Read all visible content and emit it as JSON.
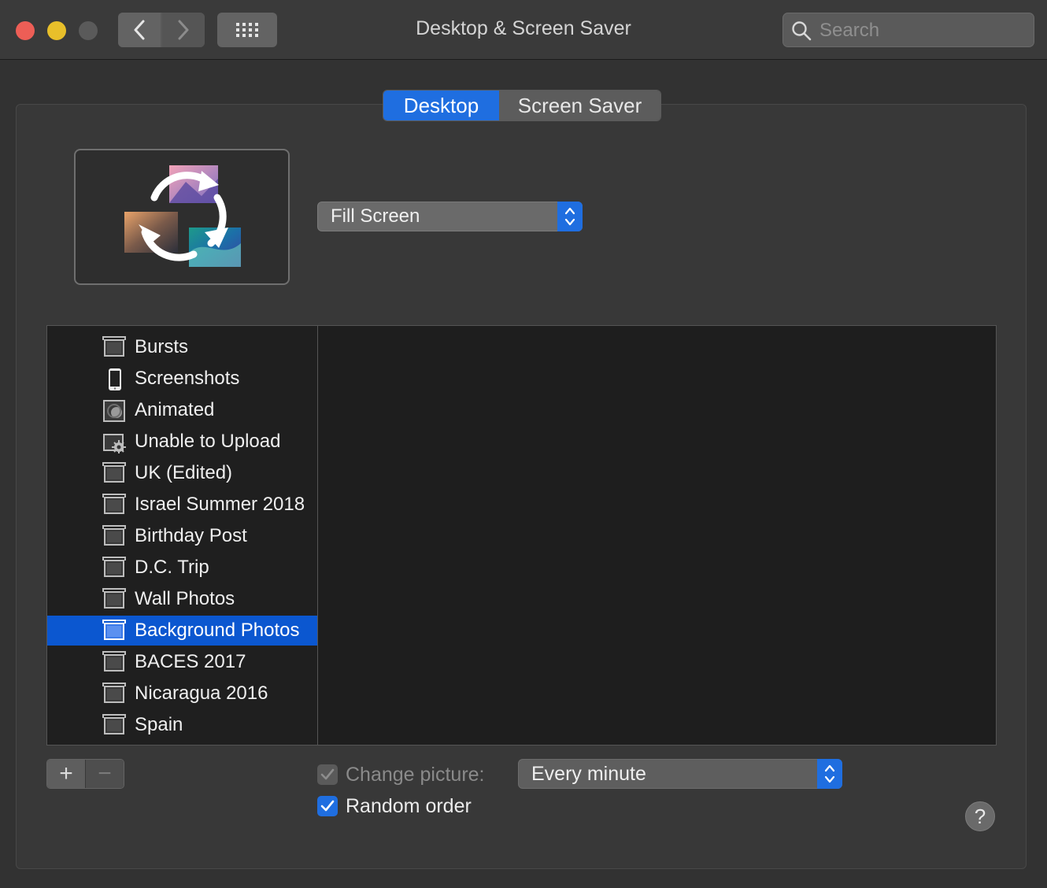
{
  "window": {
    "title": "Desktop & Screen Saver",
    "search_placeholder": "Search"
  },
  "tabs": [
    {
      "label": "Desktop",
      "active": true
    },
    {
      "label": "Screen Saver",
      "active": false
    }
  ],
  "fit_select": {
    "value": "Fill Screen"
  },
  "source_list": {
    "items": [
      {
        "label": "Bursts",
        "icon": "album-icon",
        "selected": false
      },
      {
        "label": "Screenshots",
        "icon": "phone-icon",
        "selected": false
      },
      {
        "label": "Animated",
        "icon": "animated-icon",
        "selected": false
      },
      {
        "label": "Unable to Upload",
        "icon": "gear-album-icon",
        "selected": false
      },
      {
        "label": "UK (Edited)",
        "icon": "album-icon",
        "selected": false
      },
      {
        "label": "Israel Summer 2018",
        "icon": "album-icon",
        "selected": false
      },
      {
        "label": "Birthday Post",
        "icon": "album-icon",
        "selected": false
      },
      {
        "label": "D.C. Trip",
        "icon": "album-icon",
        "selected": false
      },
      {
        "label": "Wall Photos",
        "icon": "album-icon",
        "selected": false
      },
      {
        "label": "Background Photos",
        "icon": "album-icon",
        "selected": true
      },
      {
        "label": "BACES 2017",
        "icon": "album-icon",
        "selected": false
      },
      {
        "label": "Nicaragua 2016",
        "icon": "album-icon",
        "selected": false
      },
      {
        "label": "Spain",
        "icon": "album-icon",
        "selected": false
      }
    ]
  },
  "controls": {
    "add_label": "+",
    "remove_label": "−",
    "change_picture": {
      "label": "Change picture:",
      "checked": true,
      "enabled": false
    },
    "interval": {
      "value": "Every minute"
    },
    "random_order": {
      "label": "Random order",
      "checked": true
    },
    "help_label": "?"
  },
  "colors": {
    "accent": "#1f6ee0",
    "selection": "#0b57d0"
  }
}
